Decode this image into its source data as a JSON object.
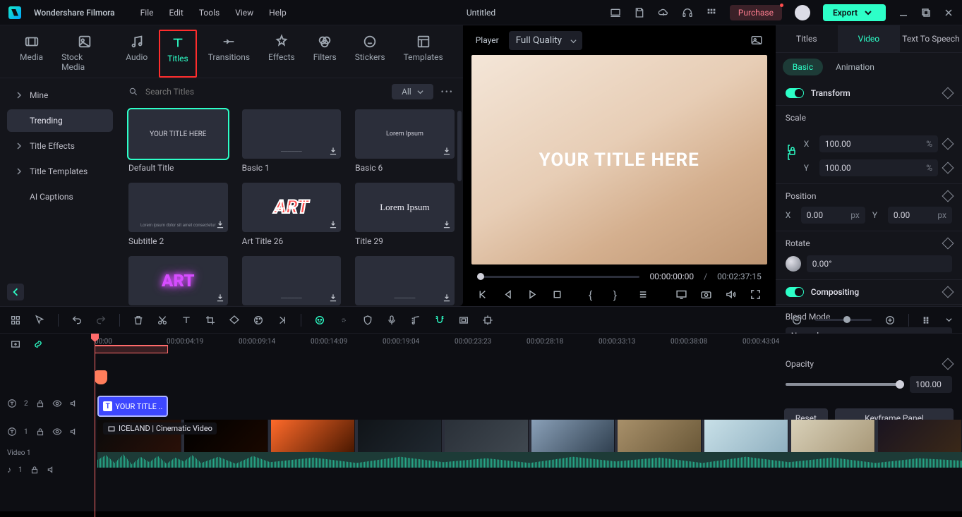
{
  "app": {
    "name": "Wondershare Filmora",
    "document": "Untitled"
  },
  "menus": [
    "File",
    "Edit",
    "Tools",
    "View",
    "Help"
  ],
  "titlebar": {
    "purchase": "Purchase",
    "export": "Export"
  },
  "assetTabs": [
    "Media",
    "Stock Media",
    "Audio",
    "Titles",
    "Transitions",
    "Effects",
    "Filters",
    "Stickers",
    "Templates"
  ],
  "sidebar": {
    "items": [
      "Mine",
      "Trending",
      "Title Effects",
      "Title Templates",
      "AI Captions"
    ]
  },
  "search": {
    "placeholder": "Search Titles",
    "filter": "All"
  },
  "titles": [
    {
      "preview": "YOUR TITLE HERE",
      "caption": "Default Title",
      "selected": true
    },
    {
      "preview": "",
      "caption": "Basic 1",
      "dl": true,
      "tinyBar": true
    },
    {
      "preview": "Lorem Ipsum",
      "caption": "Basic 6",
      "dl": true,
      "small": true
    },
    {
      "preview": "",
      "caption": "Subtitle 2",
      "dl": true,
      "tinyText": true
    },
    {
      "preview": "ART",
      "caption": "Art Title 26",
      "dl": true,
      "style": "art1"
    },
    {
      "preview": "Lorem Ipsum",
      "caption": "Title 29",
      "dl": true,
      "style": "serif"
    },
    {
      "preview": "ART",
      "caption": "",
      "dl": true,
      "style": "art2"
    },
    {
      "preview": "",
      "caption": "",
      "dl": true,
      "tinyBar": true
    },
    {
      "preview": "",
      "caption": "",
      "dl": true,
      "tinyBar": true
    }
  ],
  "player": {
    "label": "Player",
    "quality": "Full Quality",
    "canvasText": "YOUR TITLE HERE",
    "current": "00:00:00:00",
    "sep": "/",
    "total": "00:02:37:15"
  },
  "inspector": {
    "tabs": [
      "Titles",
      "Video",
      "Text To Speech"
    ],
    "sub": [
      "Basic",
      "Animation"
    ],
    "transform": "Transform",
    "scale": {
      "label": "Scale",
      "x": "100.00",
      "y": "100.00",
      "unit": "%"
    },
    "position": {
      "label": "Position",
      "x": "0.00",
      "y": "0.00",
      "unit": "px"
    },
    "rotate": {
      "label": "Rotate",
      "val": "0.00°"
    },
    "compositing": "Compositing",
    "blend": {
      "label": "Blend Mode",
      "val": "Normal"
    },
    "opacity": {
      "label": "Opacity",
      "val": "100.00"
    },
    "reset": "Reset",
    "keyframe": "Keyframe Panel"
  },
  "timeline": {
    "ticks": [
      "00:00",
      "00:00:04:19",
      "00:00:09:14",
      "00:00:14:09",
      "00:00:19:04",
      "00:00:23:23",
      "00:00:28:18",
      "00:00:33:13",
      "00:00:38:08",
      "00:00:43:04"
    ],
    "titleClip": "YOUR TITLE ...",
    "videoClip": "ICELAND | Cinematic Video",
    "videoTrack": "Video 1",
    "trackIcons": {
      "t2": "T 2",
      "t1": "T 1",
      "a1": "♪ 1"
    }
  }
}
